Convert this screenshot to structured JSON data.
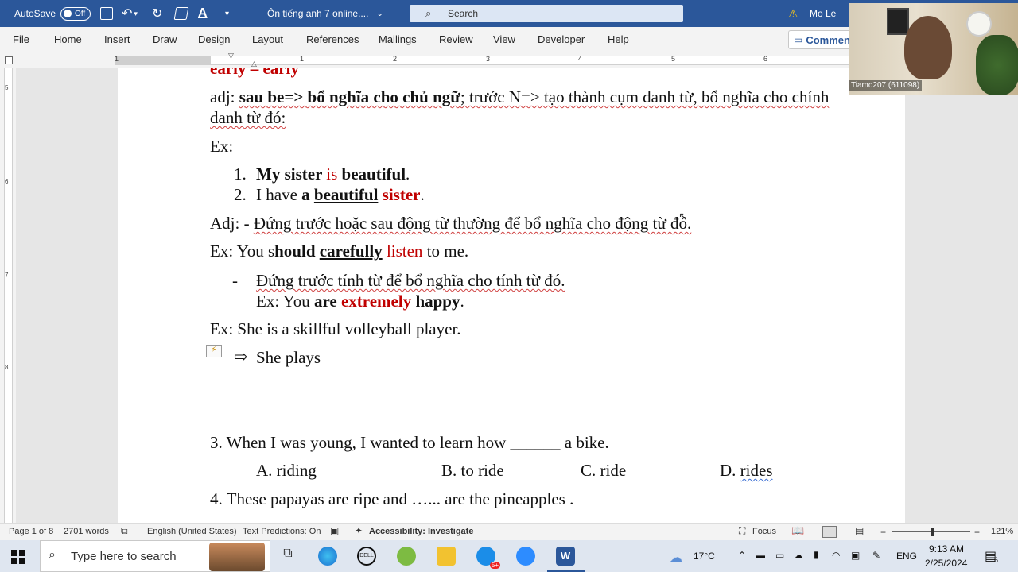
{
  "titlebar": {
    "autosave_label": "AutoSave",
    "autosave_state": "Off",
    "doc_title": "Ôn tiếng anh 7 online....",
    "search_placeholder": "Search",
    "user_name": "Mo Le"
  },
  "menu": [
    "File",
    "Home",
    "Insert",
    "Draw",
    "Design",
    "Layout",
    "References",
    "Mailings",
    "Review",
    "View",
    "Developer",
    "Help"
  ],
  "comments_label": "Commen",
  "ruler_numbers": [
    "1",
    "1",
    "2",
    "3",
    "4",
    "5",
    "6"
  ],
  "vruler_numbers": [
    "5",
    "6",
    "7",
    "8"
  ],
  "document": {
    "l0": "early – early",
    "l1a": "adj: ",
    "l1b": "sau be=> bổ nghĩa cho chủ ngữ",
    "l1c": "; trước N=> tạo thành cụm danh từ, bổ nghĩa cho chính",
    "l2": "danh từ đó:",
    "l3": "Ex:",
    "l4num": "1.",
    "l4a": "My sister ",
    "l4b": "is",
    "l4c": " beautiful",
    "l4d": ".",
    "l5num": "2.",
    "l5a": "I have ",
    "l5b": "a ",
    "l5c": "beautiful",
    "l5d": " ",
    "l5e": "sister",
    "l5f": ".",
    "l6a": "Adj: - ",
    "l6b": "Đứng trước hoặc sau động từ thường để bổ nghĩa cho động từ đó.",
    "l7a": "Ex: You s",
    "l7b": "hould ",
    "l7c": "carefully",
    "l7d": " ",
    "l7e": "listen",
    "l7f": " to me.",
    "l8dash": "-",
    "l8": "Đứng trước tính từ để bổ nghĩa cho tính từ đó.",
    "l9a": "Ex: You ",
    "l9b": "are ",
    "l9c": "extremely",
    "l9d": " ",
    "l9e": "happy",
    "l9f": ".",
    "l10": "Ex: She is a skillful volleyball player.",
    "l11arrow": "⇨",
    "l11": "She plays",
    "q3": "3. When I was young, I wanted to learn how ______ a bike.",
    "q3a": "A. riding",
    "q3b": "B. to ride",
    "q3c": "C. ride",
    "q3d_prefix": "D. ",
    "q3d": "rides",
    "q4": "4. These papayas are ripe and …... are the pineapples ."
  },
  "status": {
    "page": "Page 1 of 8",
    "words": "2701 words",
    "language": "English (United States)",
    "predictions": "Text Predictions: On",
    "accessibility": "Accessibility: Investigate",
    "focus": "Focus",
    "zoom": "121%"
  },
  "taskbar": {
    "search_placeholder": "Type here to search",
    "temperature": "17°C",
    "lang": "ENG",
    "time": "9:13 AM",
    "date": "2/25/2024",
    "notif_count": "6",
    "zalo_badge": "5+"
  },
  "video": {
    "participant": "Tiamo207 (611098)"
  }
}
